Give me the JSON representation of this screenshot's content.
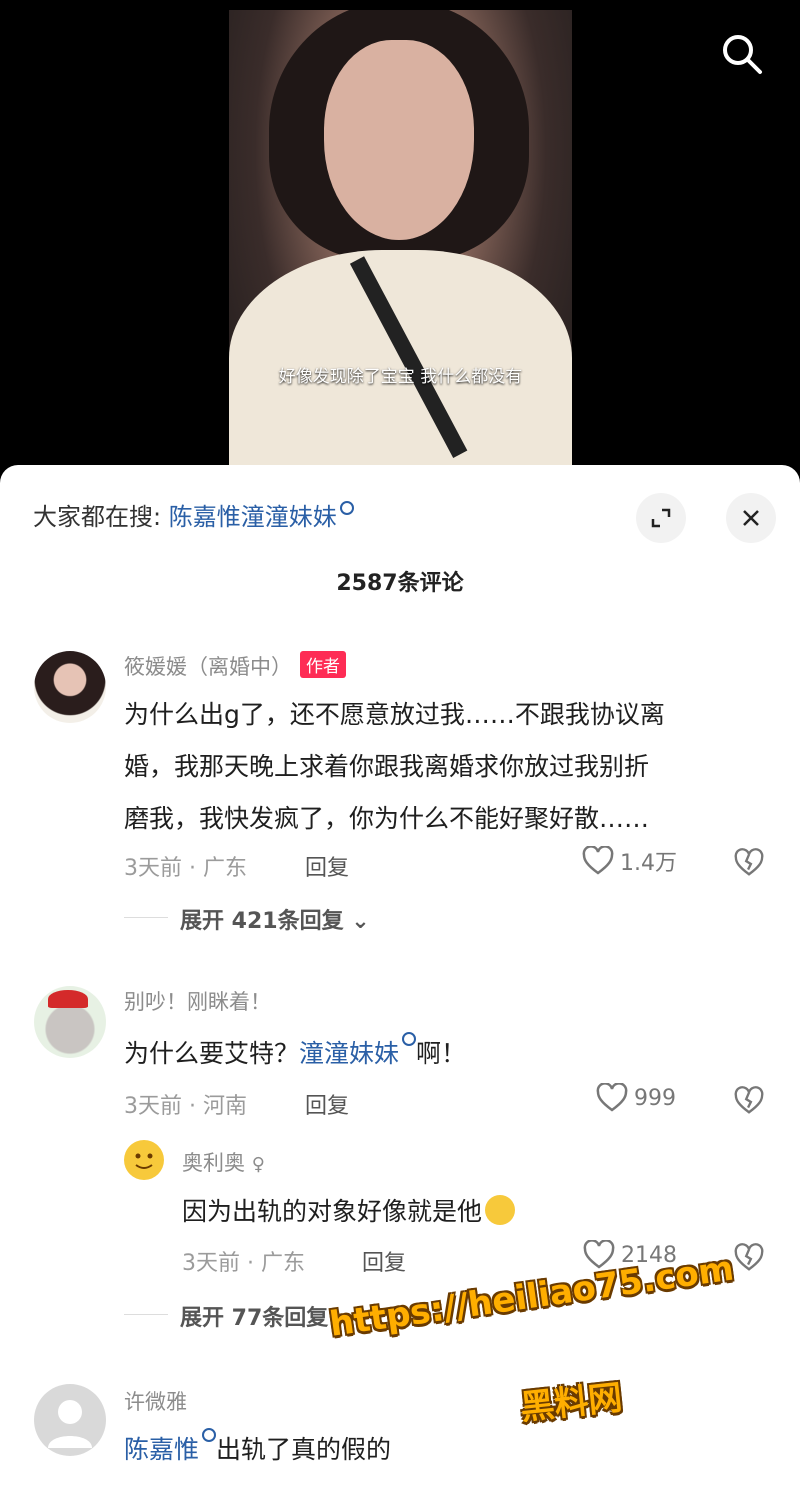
{
  "video": {
    "caption": "好像发现除了宝宝 我什么都没有"
  },
  "sheet": {
    "search_prefix": "大家都在搜:",
    "search_keyword": "陈嘉惟潼潼妹妹",
    "comment_count": "2587条评论"
  },
  "comments": [
    {
      "name": "筱媛媛（离婚中）",
      "badge": "作者",
      "line1": "为什么出g了，还不愿意放过我……不跟我协议离",
      "line2": "婚，我那天晚上求着你跟我离婚求你放过我别折",
      "line3": "磨我，我快发疯了，你为什么不能好聚好散……",
      "meta": "3天前 · 广东",
      "reply": "回复",
      "likes": "1.4万",
      "expand": "展开 421条回复"
    },
    {
      "name": "别吵！刚眯着！",
      "text_prefix": "为什么要艾特？",
      "mention": "潼潼妹妹",
      "text_suffix": "啊！",
      "meta": "3天前 · 河南",
      "reply": "回复",
      "likes": "999",
      "sub": {
        "name": "奥利奥",
        "text": "因为出轨的对象好像就是他",
        "meta": "3天前 · 广东",
        "reply": "回复",
        "likes": "2148"
      },
      "expand": "展开 77条回复"
    },
    {
      "name": "许微雅",
      "mention": "陈嘉惟",
      "text_suffix": "出轨了真的假的"
    }
  ],
  "watermark": {
    "line1": "https://heiliao75.com",
    "line2": "黑料网"
  }
}
